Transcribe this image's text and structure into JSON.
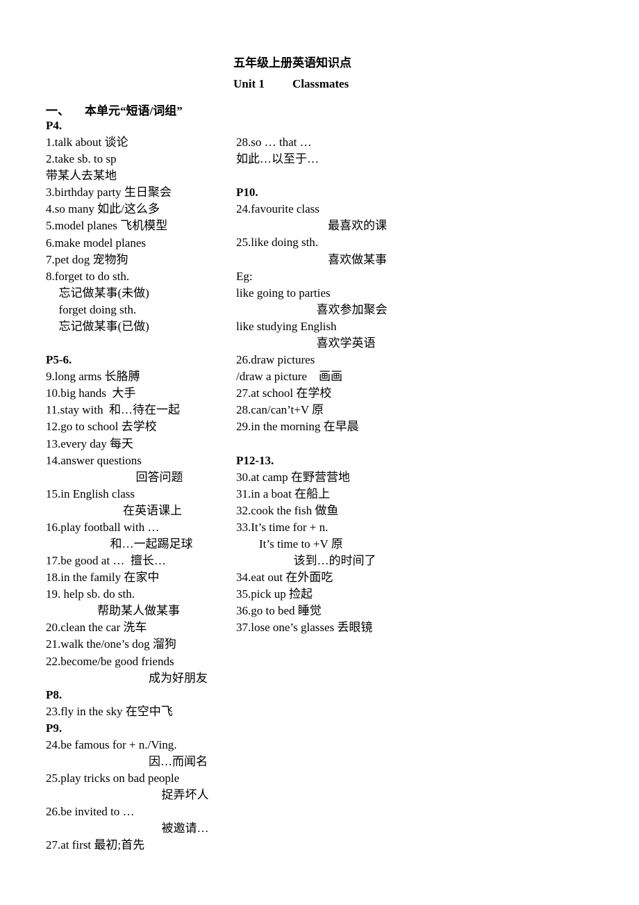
{
  "header": {
    "title": "五年级上册英语知识点",
    "unit": "Unit 1",
    "unit_name": "Classmates"
  },
  "section": {
    "number": "一、",
    "heading": "本单元“短语/词组”"
  },
  "left_column": [
    {
      "text": "P4.",
      "bold": true,
      "indent": 0
    },
    {
      "text": "1.talk about 谈论",
      "indent": 0
    },
    {
      "text": "2.take sb. to sp",
      "indent": 0
    },
    {
      "text": "带某人去某地",
      "indent": 0
    },
    {
      "text": "3.birthday party 生日聚会",
      "indent": 0
    },
    {
      "text": "4.so many 如此/这么多",
      "indent": 0
    },
    {
      "text": "5.model planes 飞机模型",
      "indent": 0
    },
    {
      "text": "6.make model planes",
      "indent": 0
    },
    {
      "text": "7.pet dog 宠物狗",
      "indent": 0
    },
    {
      "text": "8.forget to do sth.",
      "indent": 0
    },
    {
      "text": "忘记做某事(未做)",
      "indent": 1
    },
    {
      "text": "forget doing sth.",
      "indent": 1
    },
    {
      "text": "忘记做某事(已做)",
      "indent": 1
    },
    {
      "text": "",
      "indent": 0
    },
    {
      "text": "P5-6.",
      "bold": true,
      "indent": 0
    },
    {
      "text": "9.long arms 长胳膊",
      "indent": 0
    },
    {
      "text": "10.big hands  大手",
      "indent": 0
    },
    {
      "text": "11.stay with  和…待在一起",
      "indent": 0
    },
    {
      "text": "12.go to school 去学校",
      "indent": 0
    },
    {
      "text": "13.every day 每天",
      "indent": 0
    },
    {
      "text": "14.answer questions",
      "indent": 0
    },
    {
      "text": "回答问题",
      "indent": 7
    },
    {
      "text": "15.in English class",
      "indent": 0
    },
    {
      "text": "在英语课上",
      "indent": 6
    },
    {
      "text": "16.play football with …",
      "indent": 0
    },
    {
      "text": "和…一起踢足球",
      "indent": 5
    },
    {
      "text": "17.be good at …  擅长…",
      "indent": 0
    },
    {
      "text": "18.in the family 在家中",
      "indent": 0
    },
    {
      "text": "19. help sb. do sth.",
      "indent": 0
    },
    {
      "text": "帮助某人做某事",
      "indent": 4
    },
    {
      "text": "20.clean the car 洗车",
      "indent": 0
    },
    {
      "text": "21.walk the/one’s dog 溜狗",
      "indent": 0
    },
    {
      "text": "22.become/be good friends",
      "indent": 0
    },
    {
      "text": "成为好朋友",
      "indent": 8
    },
    {
      "text": "P8.",
      "bold": true,
      "indent": 0
    },
    {
      "text": "23.fly in the sky 在空中飞",
      "indent": 0
    },
    {
      "text": "P9.",
      "bold": true,
      "indent": 0
    },
    {
      "text": "24.be famous for + n./Ving.",
      "indent": 0
    },
    {
      "text": "因…而闻名",
      "indent": 8
    },
    {
      "text": "25.play tricks on bad people",
      "indent": 0
    },
    {
      "text": "捉弄坏人",
      "indent": 9
    },
    {
      "text": "26.be invited to …",
      "indent": 0
    },
    {
      "text": "被邀请…",
      "indent": 9
    },
    {
      "text": "27.at first 最初;首先",
      "indent": 0
    }
  ],
  "right_column": [
    {
      "text": "28.so … that …",
      "indent": 0
    },
    {
      "text": "如此…以至于…",
      "indent": 0
    },
    {
      "text": "",
      "indent": 0
    },
    {
      "text": "P10.",
      "bold": true,
      "indent": 0
    },
    {
      "text": "24.favourite class",
      "indent": 0
    },
    {
      "text": "最喜欢的课",
      "indent": 8
    },
    {
      "text": "25.like doing sth.",
      "indent": 0
    },
    {
      "text": "喜欢做某事",
      "indent": 8
    },
    {
      "text": "Eg:",
      "indent": 0
    },
    {
      "text": "like going to parties",
      "indent": 0
    },
    {
      "text": "喜欢参加聚会",
      "indent": 7
    },
    {
      "text": "like studying English",
      "indent": 0
    },
    {
      "text": "喜欢学英语",
      "indent": 7
    },
    {
      "text": "26.draw pictures",
      "indent": 0
    },
    {
      "text": "/draw a picture    画画",
      "indent": 0
    },
    {
      "text": "27.at school 在学校",
      "indent": 0
    },
    {
      "text": "28.can/can’t+V 原",
      "indent": 0
    },
    {
      "text": "29.in the morning 在早晨",
      "indent": 0
    },
    {
      "text": "",
      "indent": 0
    },
    {
      "text": "P12-13.",
      "bold": true,
      "indent": 0
    },
    {
      "text": "30.at camp 在野营营地",
      "indent": 0
    },
    {
      "text": "31.in a boat 在船上",
      "indent": 0
    },
    {
      "text": "32.cook the fish 做鱼",
      "indent": 0
    },
    {
      "text": "33.It’s time for + n.",
      "indent": 0
    },
    {
      "text": "It’s time to +V 原",
      "indent": 2
    },
    {
      "text": "该到…的时间了",
      "indent": 5
    },
    {
      "text": "34.eat out 在外面吃",
      "indent": 0
    },
    {
      "text": "35.pick up 捡起",
      "indent": 0
    },
    {
      "text": "36.go to bed 睡觉",
      "indent": 0
    },
    {
      "text": "37.lose one’s glasses 丢眼镜",
      "indent": 0
    }
  ]
}
